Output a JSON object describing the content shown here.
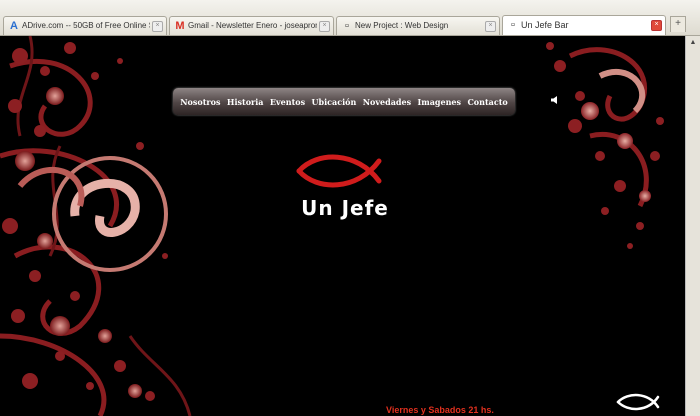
{
  "browser": {
    "tabs": [
      {
        "label": "ADrive.com -- 50GB of Free Online Sto...",
        "icon": "adrive-icon",
        "glyph": "A",
        "color": "#2a6fd0"
      },
      {
        "label": "Gmail - Newsletter Enero - joseaprona...",
        "icon": "gmail-icon",
        "glyph": "M",
        "color": "#d93025"
      },
      {
        "label": "New Project : Web Design",
        "icon": "page-icon",
        "glyph": "▫",
        "color": "#777777"
      },
      {
        "label": "Un Jefe Bar",
        "icon": "page-icon",
        "glyph": "▫",
        "color": "#777777",
        "active": true
      }
    ],
    "new_tab": "+"
  },
  "site": {
    "nav": [
      "Nosotros",
      "Historia",
      "Eventos",
      "Ubicación",
      "Novedades",
      "Imagenes",
      "Contacto"
    ],
    "title": "Un Jefe",
    "footer_text": "Viernes y Sabados 21 hs.",
    "colors": {
      "accent": "#d01c1c",
      "deco_dark": "#5a0f12",
      "deco_light": "#d9948c"
    }
  }
}
